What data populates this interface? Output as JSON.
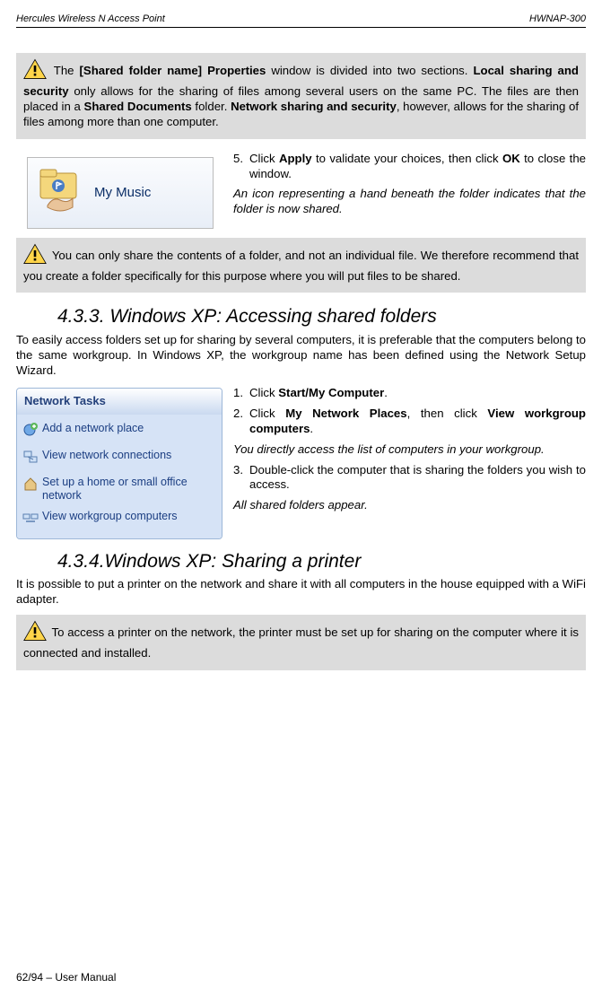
{
  "header": {
    "left": "Hercules Wireless N Access Point",
    "right": "HWNAP-300"
  },
  "box1": {
    "pre": " The ",
    "b1": "[Shared folder name] Properties",
    "mid1": " window is divided into two sections.  ",
    "b2": "Local sharing and security",
    "mid2": " only allows for the sharing of files among several users on the same PC.  The files are then placed in a ",
    "b3": "Shared Documents",
    "mid3": " folder.  ",
    "b4": "Network sharing and security",
    "mid4": ", however, allows for the sharing of files among more than one computer."
  },
  "mymusic": {
    "label": "My Music"
  },
  "step5": {
    "num": "5.",
    "t1": "Click ",
    "b1": "Apply",
    "t2": " to validate your choices, then click ",
    "b2": "OK",
    "t3": " to close the window."
  },
  "step5_note": "An icon representing a hand beneath the folder indicates that the folder is now shared.",
  "box2": {
    "text": " You can only share the contents of a folder, and not an individual file.  We therefore recommend that you create a folder specifically for this purpose where you will put files to be shared."
  },
  "sec433": {
    "title": "4.3.3. Windows XP: Accessing shared folders",
    "intro": "To easily access folders set up for sharing by several computers, it is preferable that the computers belong to the same workgroup.  In Windows XP, the workgroup name has been defined using the Network Setup Wizard."
  },
  "nettasks": {
    "title": "Network Tasks",
    "items": [
      "Add a network place",
      "View network connections",
      "Set up a home or small office network",
      "View workgroup computers"
    ]
  },
  "rightcol": {
    "s1": {
      "num": "1.",
      "t1": "Click ",
      "b1": "Start/My Computer",
      "t2": "."
    },
    "s2": {
      "num": "2.",
      "t1": "Click ",
      "b1": "My Network Places",
      "t2": ", then click ",
      "b2": "View workgroup computers",
      "t3": "."
    },
    "note1": "You directly access the list of computers in your workgroup.",
    "s3": {
      "num": "3.",
      "t": "Double-click the computer that is sharing the folders you wish to access."
    },
    "note2": "All shared folders appear."
  },
  "sec434": {
    "title": "4.3.4.Windows XP: Sharing a printer",
    "intro": "It is possible to put a printer on the network and share it with all computers in the house equipped with a WiFi adapter."
  },
  "box3": {
    "text": " To access a printer on the network, the printer must be set up for sharing on the computer where it is connected and installed."
  },
  "footer": "62/94 – User Manual"
}
